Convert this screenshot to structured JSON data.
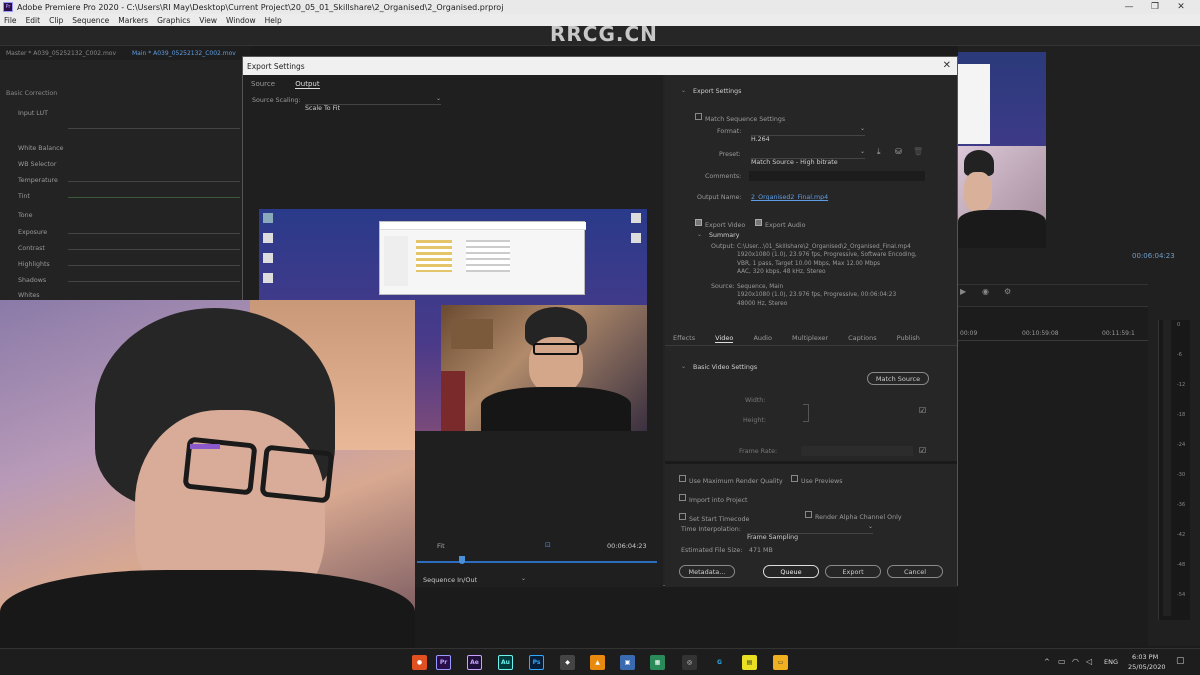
{
  "app": {
    "title": "Adobe Premiere Pro 2020 - C:\\Users\\RI May\\Desktop\\Current Project\\20_05_01_Skillshare\\2_Organised\\2_Organised.prproj",
    "menu": [
      "File",
      "Edit",
      "Clip",
      "Sequence",
      "Markers",
      "Graphics",
      "View",
      "Window",
      "Help"
    ],
    "window_controls": {
      "minimize": "—",
      "maximize": "❐",
      "close": "✕"
    }
  },
  "watermark": "RRCG.CN",
  "left_panel": {
    "tabs": [
      "Master * A039_05252132_C002.mov",
      "Main * A039_05252132_C002.mov"
    ],
    "header": "Basic Correction",
    "rows": [
      "Input LUT",
      "",
      "White Balance",
      "WB Selector",
      "Temperature",
      "Tint",
      "Tone",
      "Exposure",
      "Contrast",
      "Highlights",
      "Shadows",
      "Whites"
    ]
  },
  "dialog": {
    "title": "Export Settings",
    "close": "✕",
    "source_tabs": {
      "source": "Source",
      "output": "Output"
    },
    "source_scaling_label": "Source Scaling:",
    "source_scaling_value": "Scale To Fit",
    "export_settings_header": "Export Settings",
    "match_sequence": "Match Sequence Settings",
    "format_label": "Format:",
    "format_value": "H.264",
    "preset_label": "Preset:",
    "preset_value": "Match Source - High bitrate",
    "comments_label": "Comments:",
    "output_name_label": "Output Name:",
    "output_name_value": "2_Organised2_Final.mp4",
    "export_video": "Export Video",
    "export_audio": "Export Audio",
    "summary_header": "Summary",
    "summary_output_label": "Output:",
    "summary_output_lines": [
      "C:\\User...\\01_Skillshare\\2_Organised\\2_Organised_Final.mp4",
      "1920x1080 (1.0), 23.976 fps, Progressive, Software Encoding,",
      "VBR, 1 pass, Target 10.00 Mbps, Max 12.00 Mbps",
      "AAC, 320 kbps, 48 kHz, Stereo"
    ],
    "summary_source_label": "Source:",
    "summary_source_lines": [
      "Sequence, Main",
      "1920x1080 (1.0), 23.976 fps, Progressive, 00:06:04:23",
      "48000 Hz, Stereo"
    ],
    "settings_tabs": [
      "Effects",
      "Video",
      "Audio",
      "Multiplexer",
      "Captions",
      "Publish"
    ],
    "basic_video_header": "Basic Video Settings",
    "match_source_btn": "Match Source",
    "width_label": "Width:",
    "height_label": "Height:",
    "frame_rate_label": "Frame Rate:",
    "use_max_render": "Use Maximum Render Quality",
    "use_previews": "Use Previews",
    "import_into_project": "Import into Project",
    "set_start_timecode": "Set Start Timecode",
    "render_alpha": "Render Alpha Channel Only",
    "time_interp_label": "Time Interpolation:",
    "time_interp_value": "Frame Sampling",
    "file_size_label": "Estimated File Size:",
    "file_size_value": "471 MB",
    "buttons": {
      "metadata": "Metadata...",
      "queue": "Queue",
      "export": "Export",
      "cancel": "Cancel"
    },
    "fit_label": "Fit",
    "timecode": "00:06:04:23",
    "range_value": "Sequence In/Out"
  },
  "right_panel": {
    "timecode": "00:06:04:23",
    "timeline_marks": [
      "00:09",
      "00:10:59:08",
      "00:11:59:1"
    ],
    "meter_ticks": [
      "0",
      "-6",
      "-12",
      "-18",
      "-24",
      "-30",
      "-36",
      "-42",
      "-48",
      "-54"
    ]
  },
  "taskbar": {
    "apps": [
      {
        "label": "Pr",
        "color": "#2a0e4a",
        "fg": "#b8a6ff"
      },
      {
        "label": "Ae",
        "color": "#1f0e3a",
        "fg": "#c7a3ff"
      },
      {
        "label": "Au",
        "color": "#003a3a",
        "fg": "#6df2ef"
      },
      {
        "label": "Ps",
        "color": "#061e3a",
        "fg": "#31a8ff"
      }
    ],
    "lang": "ENG",
    "time": "6:03 PM",
    "date": "25/05/2020"
  }
}
